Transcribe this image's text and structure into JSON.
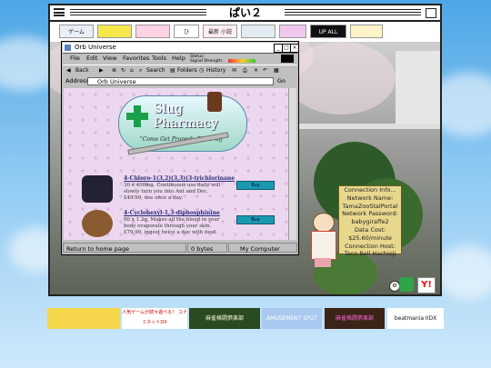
{
  "window": {
    "title": "ぱい２"
  },
  "banners": [
    {
      "label": "ゲーム"
    },
    {
      "label": ""
    },
    {
      "label": ""
    },
    {
      "label": "ひ"
    },
    {
      "label": "最新 小説"
    },
    {
      "label": ""
    },
    {
      "label": ""
    },
    {
      "label": "UP ALL NIGHT"
    },
    {
      "label": ""
    }
  ],
  "browser": {
    "title": "Orb Universe",
    "menu": [
      "File",
      "Edit",
      "View",
      "Favorites",
      "Tools",
      "Help"
    ],
    "signal": {
      "status_label": "Status:",
      "signal_label": "Signal Strength:"
    },
    "toolbar": {
      "back": "Back",
      "search": "Search",
      "folders": "Folders",
      "history": "History",
      "go": "Go"
    },
    "address_label": "Address",
    "address_value": "Orb Universe",
    "status": {
      "link": "Return to home page",
      "bytes": "0 bytes",
      "zone": "My Computer"
    }
  },
  "pharmacy": {
    "name1": "Slug",
    "name2": "Pharmacy",
    "tagline": "\"Come Get Properly Filled Off\"",
    "products": [
      {
        "name": "4-Chloro-1(3,2)(3,3)(3-trichlorinane",
        "desc": "30 x 400mg. Continuous use daily will slowly turn you into Ant and Dec. £49.99, use once a day.",
        "buy": "Buy"
      },
      {
        "name": "4-Cyclohexyl-1,3-diphosphinine",
        "desc": "90 x 1.2g. Makes all the blood in your body evaporate through your skin. £79.99, ingest twice a day with food.",
        "buy": "Buy"
      }
    ]
  },
  "connection": {
    "lines": [
      "Connection Info...",
      "Network Name:",
      "TamaZooStalPortal",
      "Network Password:",
      "babygiraffe2",
      "Data Cost:",
      "$25.60/minute",
      "Connection Host:",
      "Taco Bell Hachioji"
    ]
  },
  "bottom_ads": [
    {
      "label": ""
    },
    {
      "label": "人気ゲームが続々遊べる！ コナミネットDX"
    },
    {
      "label": "麻雀格闘倶楽部"
    },
    {
      "label": "AMUSEMENT SPOT"
    },
    {
      "label": "麻雀格闘倶楽部"
    },
    {
      "label": "beatmania IIDX"
    }
  ],
  "colors": {
    "sky": "#4ea6e6",
    "page_bg": "#ecd8ee",
    "buy": "#1a9ab0",
    "panel": "#e8d88e"
  }
}
